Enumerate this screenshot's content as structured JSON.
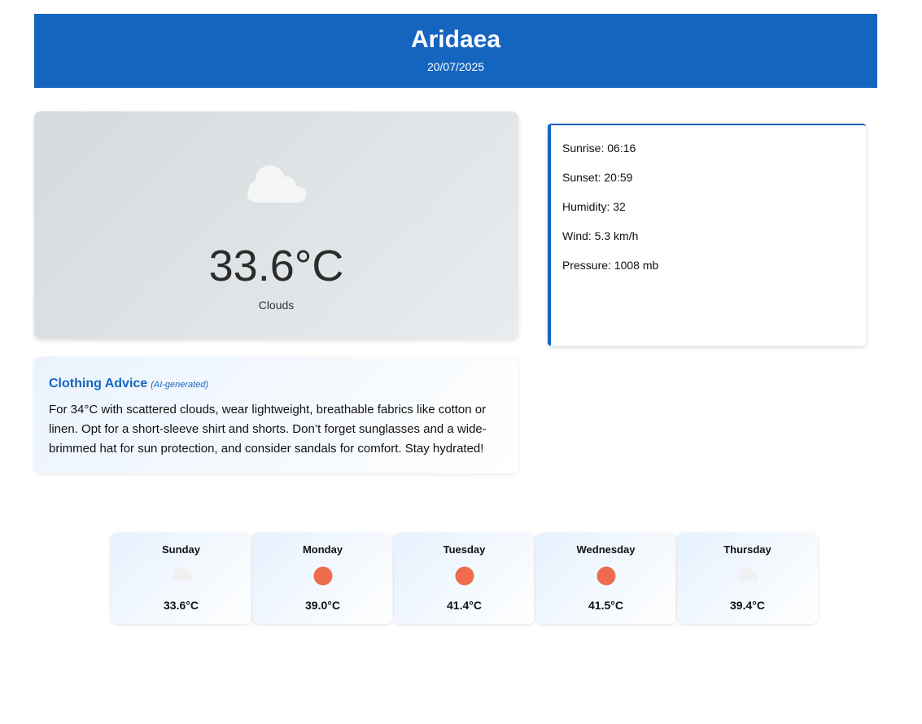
{
  "header": {
    "city": "Aridaea",
    "date": "20/07/2025"
  },
  "current": {
    "icon": "cloud-icon",
    "temperature": "33.6°C",
    "description": "Clouds"
  },
  "details": {
    "sunrise": "Sunrise: 06:16",
    "sunset": "Sunset: 20:59",
    "humidity": "Humidity: 32",
    "wind": "Wind: 5.3 km/h",
    "pressure": "Pressure: 1008 mb"
  },
  "advice": {
    "title": "Clothing Advice",
    "tag": "(AI-generated)",
    "text": "For 34°C with scattered clouds, wear lightweight, breathable fabrics like cotton or linen. Opt for a short-sleeve shirt and shorts. Don’t forget sunglasses and a wide-brimmed hat for sun protection, and consider sandals for comfort. Stay hydrated!"
  },
  "forecast": [
    {
      "day": "Sunday",
      "icon": "cloud-icon",
      "temp": "33.6°C"
    },
    {
      "day": "Monday",
      "icon": "sun-icon",
      "temp": "39.0°C"
    },
    {
      "day": "Tuesday",
      "icon": "sun-icon",
      "temp": "41.4°C"
    },
    {
      "day": "Wednesday",
      "icon": "sun-icon",
      "temp": "41.5°C"
    },
    {
      "day": "Thursday",
      "icon": "cloud-icon",
      "temp": "39.4°C"
    }
  ],
  "colors": {
    "accent": "#1565c0",
    "sun": "#ee6c4d",
    "cloud": "#f2f2f2"
  }
}
